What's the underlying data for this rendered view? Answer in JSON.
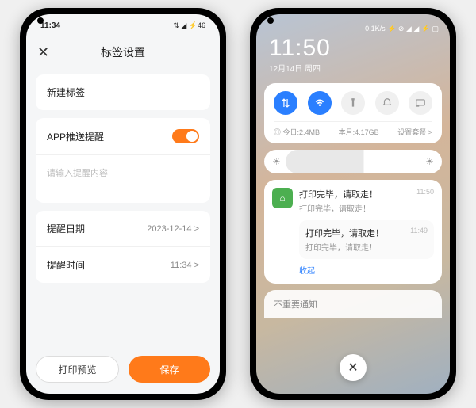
{
  "phone1": {
    "status": {
      "time": "11:34",
      "signal": "⇅ ◢ ⚡46"
    },
    "header": {
      "title": "标签设置"
    },
    "newTag": {
      "label": "新建标签"
    },
    "push": {
      "label": "APP推送提醒",
      "toggle_on": true
    },
    "content": {
      "placeholder": "请输入提醒内容"
    },
    "date": {
      "label": "提醒日期",
      "value": "2023-12-14 >"
    },
    "time": {
      "label": "提醒时间",
      "value": "11:34 >"
    },
    "footer": {
      "preview": "打印预览",
      "save": "保存"
    }
  },
  "phone2": {
    "status": {
      "speed": "0.1K/s ⚡ ⊘ ◢ ◢ ⚡ ▢"
    },
    "clock": {
      "time": "11:50",
      "date": "12月14日 周四"
    },
    "qs": {
      "data_today": "◎ 今日:2.4MB",
      "data_month": "本月:4.17GB",
      "settings": "设置套餐 >"
    },
    "notif": {
      "title": "打印完毕，请取走！",
      "sub": "打印完毕，请取走！",
      "time": "11:50",
      "nested_title": "打印完毕，请取走！",
      "nested_sub": "打印完毕，请取走！",
      "nested_time": "11:49",
      "collapse": "收起"
    },
    "low": {
      "label": "不重要通知"
    }
  }
}
